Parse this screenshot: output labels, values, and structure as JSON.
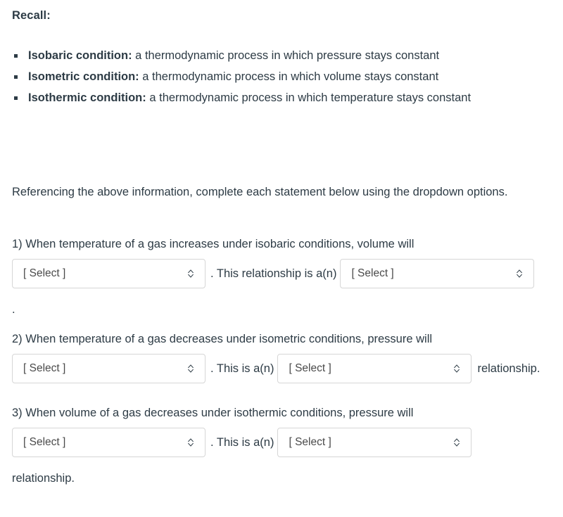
{
  "heading": {
    "recall_label": "Recall:"
  },
  "definitions": [
    {
      "term": "Isobaric condition:",
      "description": " a thermodynamic process in which pressure stays constant",
      "bullet_icon": "square-bullet-icon"
    },
    {
      "term": "Isometric condition:",
      "description": " a thermodynamic process in which volume stays constant",
      "bullet_icon": "square-bullet-icon"
    },
    {
      "term": "Isothermic condition:",
      "description": " a thermodynamic process in which temperature stays constant",
      "bullet_icon": "square-bullet-icon"
    }
  ],
  "intro": {
    "paragraph": "Referencing the above information, complete each statement below using the dropdown options."
  },
  "select": {
    "placeholder": "[ Select ]",
    "chevron_icon": "chevron-up-down-icon"
  },
  "questions": [
    {
      "prompt": "1) When temperature of a gas increases under isobaric conditions, volume will",
      "select_one_value": "[ Select ]",
      "middle_text": ". This relationship is a(n)",
      "select_two_value": "[ Select ]",
      "trailing_text": "",
      "orphan_period": "."
    },
    {
      "prompt": "2) When temperature of a gas decreases under isometric conditions, pressure will",
      "select_one_value": "[ Select ]",
      "middle_text": ". This is a(n)",
      "select_two_value": "[ Select ]",
      "trailing_text": "relationship."
    },
    {
      "prompt": "3) When volume of a gas decreases under isothermic conditions, pressure will",
      "select_one_value": "[ Select ]",
      "middle_text": ". This is a(n)",
      "select_two_value": "[ Select ]",
      "trailing_text": "relationship."
    }
  ],
  "colors": {
    "text": "#2d3b45",
    "select_border": "#d6d6d6",
    "select_text": "#4a4a4a",
    "background": "#ffffff"
  }
}
